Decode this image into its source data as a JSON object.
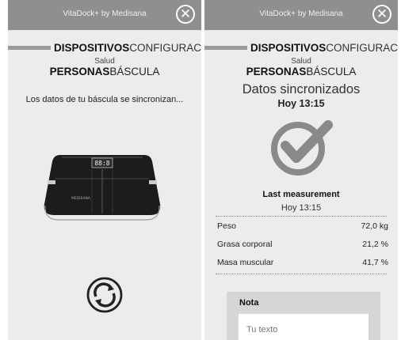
{
  "left": {
    "title": "VitaDock+ by Medisana",
    "close_glyph": "✕",
    "nav_devices": "DISPOSITIVOS",
    "nav_config": "CONFIGURACIÓN",
    "health": "Salud",
    "nav_people": "PERSONAS",
    "nav_scale": "BÁSCULA",
    "sync_message": "Los datos de tu báscula se sincronizan...",
    "scale_display": "88:8",
    "scale_brand": "MEDISANA",
    "icons": {
      "sync": "sync-icon",
      "scale": "scale-image"
    }
  },
  "right": {
    "title": "VitaDock+ by Medisana",
    "close_glyph": "✕",
    "nav_devices": "DISPOSITIVOS",
    "nav_config": "CONFIGURACIÓN",
    "health": "Salud",
    "nav_people": "PERSONAS",
    "nav_scale": "BÁSCULA",
    "synced_title": "Datos sincronizados",
    "synced_time": "Hoy 13:15",
    "last_measurement_label": "Last measurement",
    "last_measurement_time": "Hoy 13:15",
    "measurements": [
      {
        "label": "Peso",
        "value": "72,0 kg"
      },
      {
        "label": "Grasa corporal",
        "value": "21,2 %"
      },
      {
        "label": "Masa muscular",
        "value": "41,7 %"
      }
    ],
    "note_label": "Nota",
    "note_placeholder": "Tu texto",
    "icons": {
      "check": "check-circle-icon"
    }
  },
  "colors": {
    "titlebar": "#8f8f8f",
    "background": "#ececec",
    "check": "#8a8a8a"
  }
}
